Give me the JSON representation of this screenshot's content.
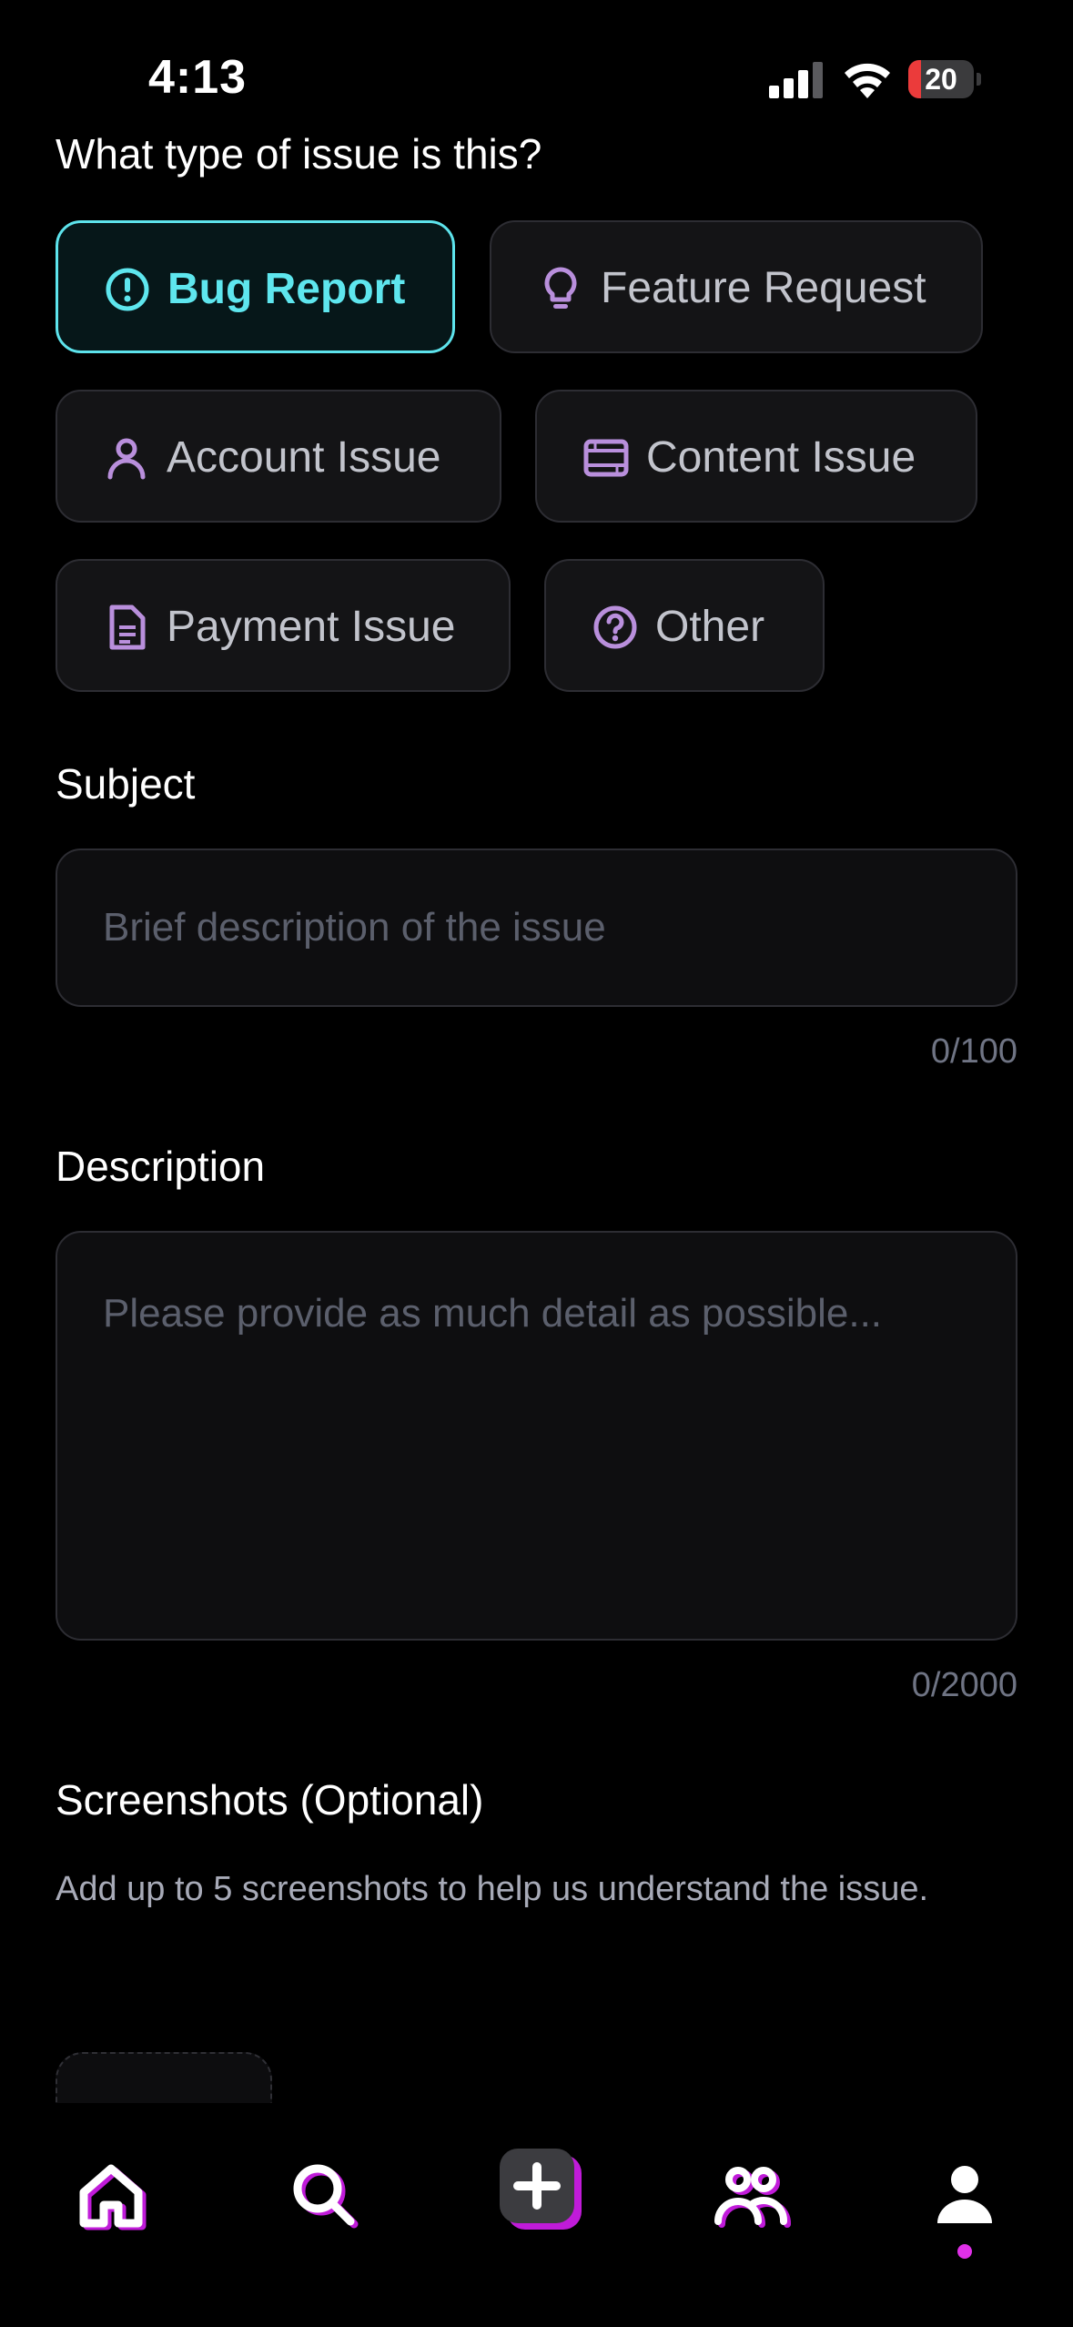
{
  "status_bar": {
    "time": "4:13",
    "battery_level": "20",
    "battery_color": "#eb3b3b"
  },
  "form": {
    "issue_type_label": "What type of issue is this?",
    "issue_types": [
      {
        "label": "Bug Report",
        "icon": "exclamation-circle-icon",
        "selected": true
      },
      {
        "label": "Feature Request",
        "icon": "lightbulb-icon",
        "selected": false
      },
      {
        "label": "Account Issue",
        "icon": "person-icon",
        "selected": false
      },
      {
        "label": "Content Issue",
        "icon": "film-icon",
        "selected": false
      },
      {
        "label": "Payment Issue",
        "icon": "document-icon",
        "selected": false
      },
      {
        "label": "Other",
        "icon": "question-circle-icon",
        "selected": false
      }
    ],
    "subject": {
      "label": "Subject",
      "placeholder": "Brief description of the issue",
      "value": "",
      "counter": "0/100"
    },
    "description": {
      "label": "Description",
      "placeholder": "Please provide as much detail as possible...",
      "value": "",
      "counter": "0/2000"
    },
    "screenshots": {
      "label": "Screenshots (Optional)",
      "help": "Add up to 5 screenshots to help us understand the issue."
    }
  },
  "bottom_nav": {
    "items": [
      {
        "icon": "home-icon",
        "active": false
      },
      {
        "icon": "search-icon",
        "active": false
      },
      {
        "icon": "create-plus-icon",
        "active": false
      },
      {
        "icon": "friends-icon",
        "active": false
      },
      {
        "icon": "profile-icon",
        "active": true
      }
    ]
  },
  "colors": {
    "accent_cyan": "#5ee6ee",
    "accent_magenta": "#e030e8",
    "icon_purple": "#b98fdc"
  }
}
